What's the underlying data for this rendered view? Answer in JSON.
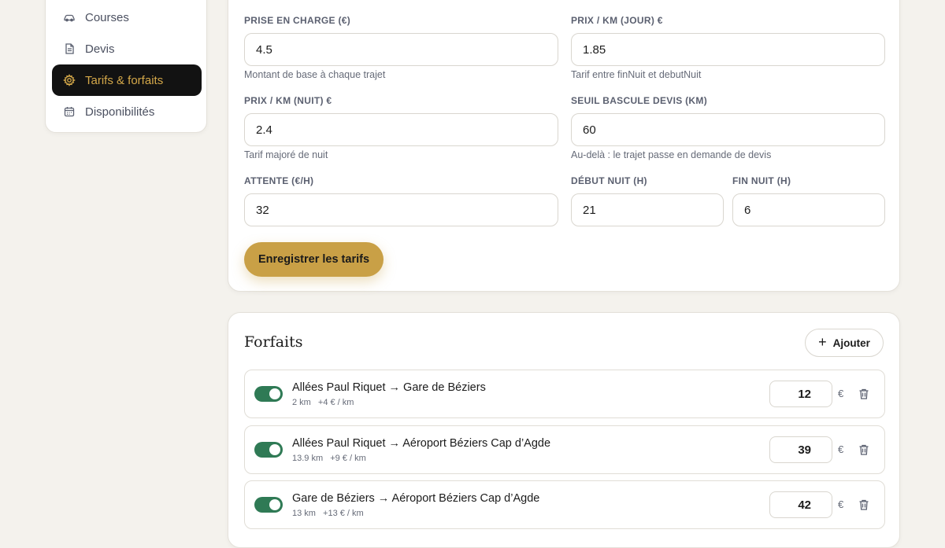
{
  "sidebar": {
    "items": [
      {
        "label": "Courses",
        "icon": "car-icon"
      },
      {
        "label": "Devis",
        "icon": "document-icon"
      },
      {
        "label": "Tarifs & forfaits",
        "icon": "gear-icon",
        "active": true
      },
      {
        "label": "Disponibilités",
        "icon": "calendar-icon"
      }
    ]
  },
  "tarifs": {
    "fields": {
      "prise_en_charge": {
        "label": "PRISE EN CHARGE (€)",
        "value": "4.5",
        "help": "Montant de base à chaque trajet"
      },
      "prix_km_jour": {
        "label": "PRIX / KM (JOUR) €",
        "value": "1.85",
        "help": "Tarif entre finNuit et debutNuit"
      },
      "prix_km_nuit": {
        "label": "PRIX / KM (NUIT) €",
        "value": "2.4",
        "help": "Tarif majoré de nuit"
      },
      "seuil_devis": {
        "label": "SEUIL BASCULE DEVIS (KM)",
        "value": "60",
        "help": "Au-delà : le trajet passe en demande de devis"
      },
      "attente": {
        "label": "ATTENTE (€/H)",
        "value": "32"
      },
      "debut_nuit": {
        "label": "DÉBUT NUIT (H)",
        "value": "21"
      },
      "fin_nuit": {
        "label": "FIN NUIT (H)",
        "value": "6"
      }
    },
    "save_label": "Enregistrer les tarifs"
  },
  "forfaits": {
    "title": "Forfaits",
    "add_label": "Ajouter",
    "currency": "€",
    "items": [
      {
        "route": "Allées Paul Riquet → Gare de Béziers",
        "distance": "2 km",
        "surcharge": "+4 € / km",
        "price": "12",
        "enabled": true
      },
      {
        "route": "Allées Paul Riquet → Aéroport Béziers Cap d’Agde",
        "distance": "13.9 km",
        "surcharge": "+9 € / km",
        "price": "39",
        "enabled": true
      },
      {
        "route": "Gare de Béziers → Aéroport Béziers Cap d’Agde",
        "distance": "13 km",
        "surcharge": "+13 € / km",
        "price": "42",
        "enabled": true
      }
    ]
  },
  "colors": {
    "accent": "#c9a046",
    "active_nav_bg": "#121212",
    "active_nav_text": "#d4a849",
    "toggle_on": "#2f7a55",
    "background": "#f4f2ed"
  }
}
